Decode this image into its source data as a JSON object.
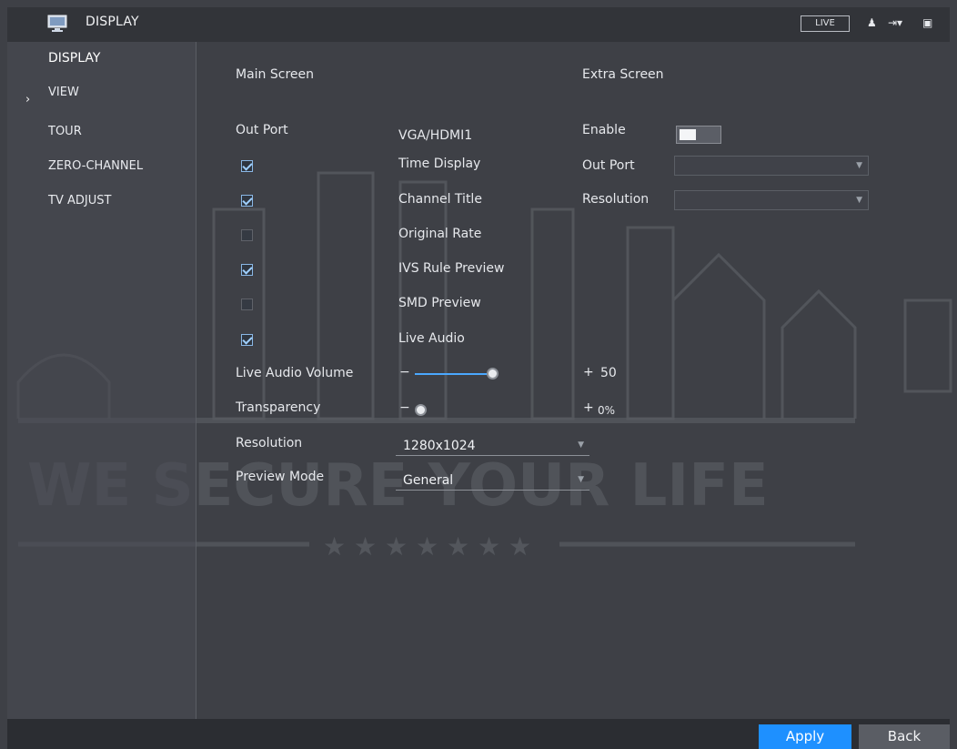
{
  "window": {
    "title": "DISPLAY",
    "live_label": "LIVE"
  },
  "sidebar": {
    "items": [
      {
        "label": "DISPLAY",
        "active": true
      },
      {
        "label": "VIEW"
      },
      {
        "label": "TOUR"
      },
      {
        "label": "ZERO-CHANNEL"
      },
      {
        "label": "TV ADJUST"
      }
    ]
  },
  "main_screen": {
    "heading": "Main Screen",
    "out_port_label": "Out Port",
    "out_port_value": "VGA/HDMI1",
    "options": [
      {
        "label": "Time Display",
        "checked": true
      },
      {
        "label": "Channel Title",
        "checked": true
      },
      {
        "label": "Original Rate",
        "checked": false
      },
      {
        "label": "IVS Rule Preview",
        "checked": true
      },
      {
        "label": "SMD Preview",
        "checked": false
      },
      {
        "label": "Live Audio",
        "checked": true
      }
    ],
    "live_audio_volume": {
      "label": "Live Audio Volume",
      "value": 50,
      "display": "50"
    },
    "transparency": {
      "label": "Transparency",
      "value": 0,
      "display": "0%"
    },
    "resolution": {
      "label": "Resolution",
      "value": "1280x1024"
    },
    "preview_mode": {
      "label": "Preview Mode",
      "value": "General"
    }
  },
  "extra_screen": {
    "heading": "Extra Screen",
    "enable_label": "Enable",
    "enabled": false,
    "out_port_label": "Out Port",
    "resolution_label": "Resolution"
  },
  "background": {
    "tagline": "WE SECURE YOUR LIFE"
  },
  "buttons": {
    "apply": "Apply",
    "back": "Back"
  },
  "colors": {
    "accent": "#1e90ff",
    "background": "#3e4046",
    "checkbox": "#8ab8e6"
  }
}
